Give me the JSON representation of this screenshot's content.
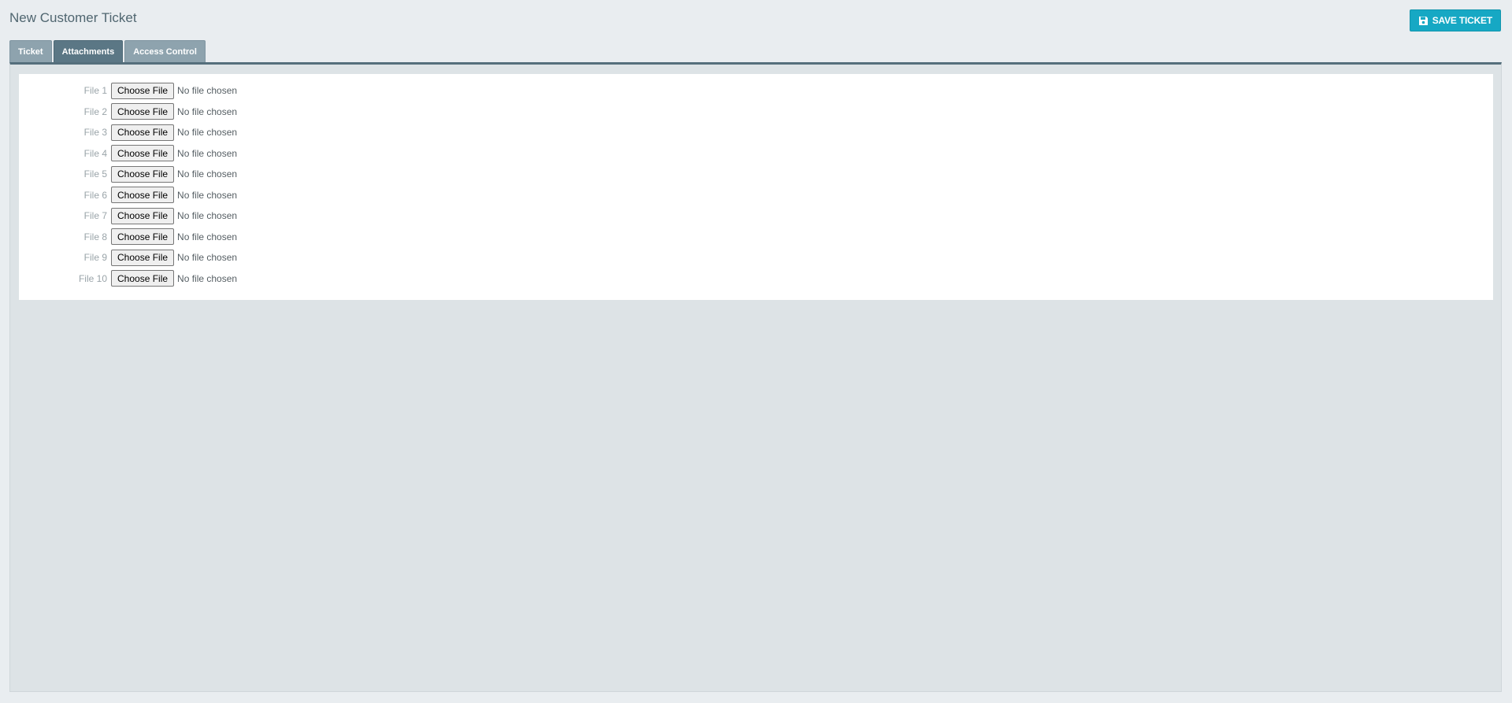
{
  "header": {
    "title": "New Customer Ticket",
    "save_label": "SAVE TICKET",
    "save_icon": "floppy-disk-icon"
  },
  "tabs": [
    {
      "label": "Ticket",
      "active": false
    },
    {
      "label": "Attachments",
      "active": true
    },
    {
      "label": "Access Control",
      "active": false
    }
  ],
  "attachments": {
    "button_label": "Choose File",
    "files": [
      {
        "label": "File 1",
        "status": "No file chosen"
      },
      {
        "label": "File 2",
        "status": "No file chosen"
      },
      {
        "label": "File 3",
        "status": "No file chosen"
      },
      {
        "label": "File 4",
        "status": "No file chosen"
      },
      {
        "label": "File 5",
        "status": "No file chosen"
      },
      {
        "label": "File 6",
        "status": "No file chosen"
      },
      {
        "label": "File 7",
        "status": "No file chosen"
      },
      {
        "label": "File 8",
        "status": "No file chosen"
      },
      {
        "label": "File 9",
        "status": "No file chosen"
      },
      {
        "label": "File 10",
        "status": "No file chosen"
      }
    ]
  },
  "colors": {
    "accent": "#16a8c4",
    "tab_active": "#5b7785",
    "tab_inactive": "#8ea3ae",
    "title": "#506670"
  }
}
